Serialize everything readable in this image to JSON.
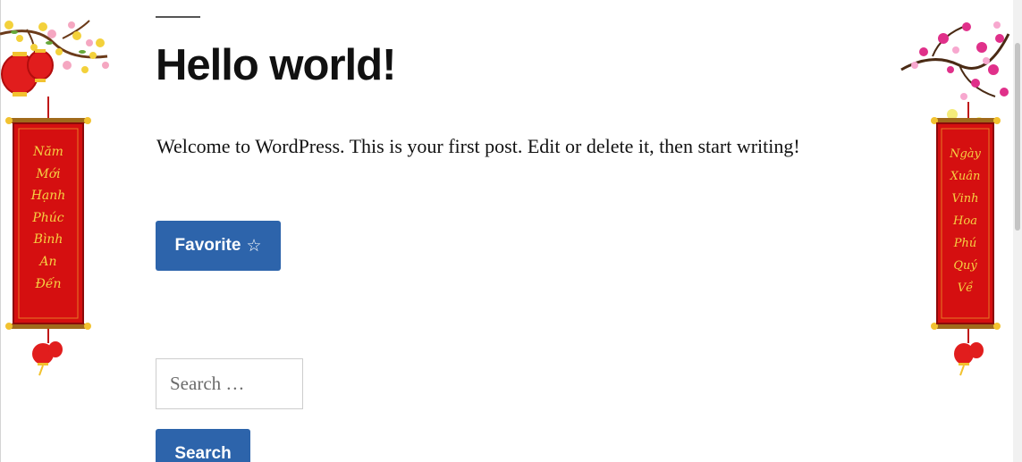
{
  "post": {
    "title": "Hello world!",
    "body": "Welcome to WordPress. This is your first post. Edit or delete it, then start writing!"
  },
  "favorite_button": {
    "label": "Favorite",
    "icon_glyph": "☆",
    "icon": "star-outline-icon"
  },
  "search": {
    "placeholder": "Search …",
    "button_label": "Search"
  },
  "decorations": {
    "left_banner": {
      "lines": [
        "Năm",
        "Mới",
        "Hạnh",
        "Phúc",
        "Bình",
        "An",
        "Đến"
      ]
    },
    "right_banner": {
      "lines": [
        "Ngày",
        "Xuân",
        "Vinh",
        "Hoa",
        "Phú",
        "Quý",
        "Về"
      ]
    },
    "colors": {
      "accent_blue": "#2d64ab",
      "banner_red": "#d50f10",
      "banner_text_gold": "#f5d142"
    }
  }
}
